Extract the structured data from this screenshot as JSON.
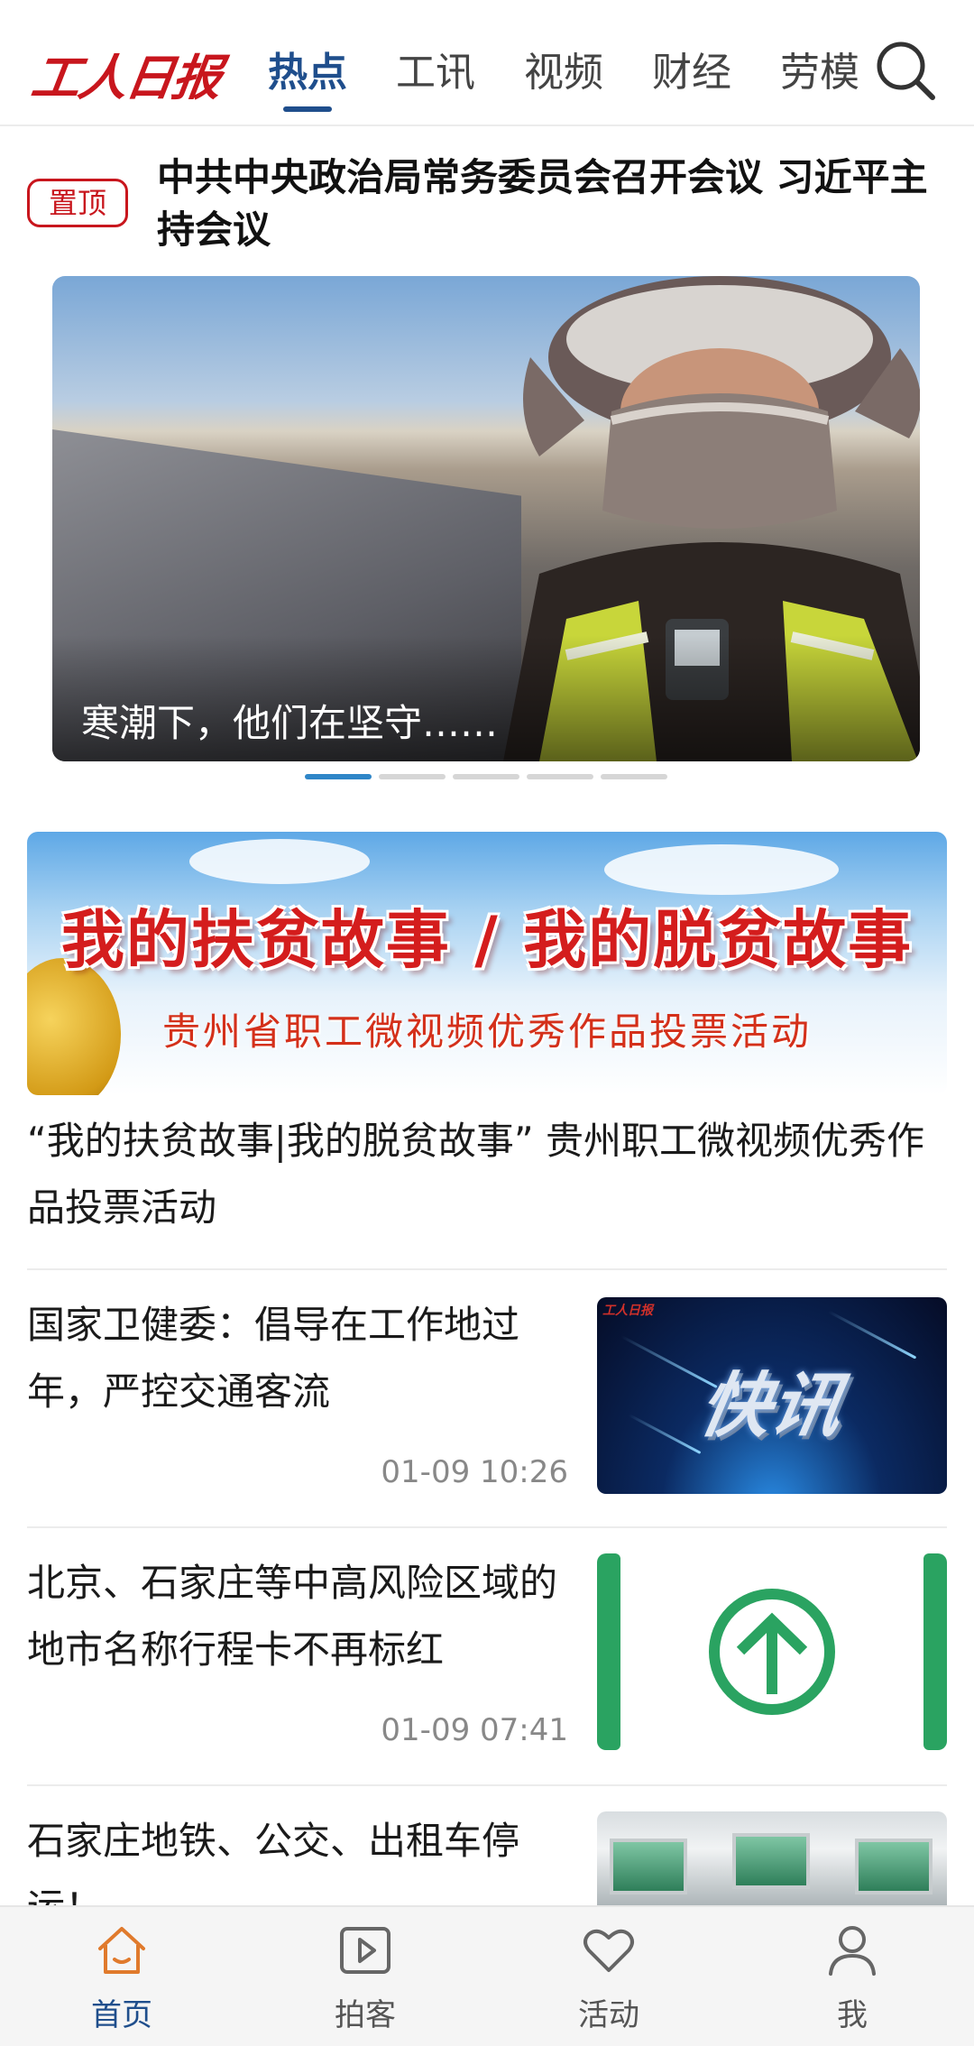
{
  "header": {
    "logo_text": "工人日报",
    "tabs": [
      {
        "label": "热点",
        "active": true
      },
      {
        "label": "工讯",
        "active": false
      },
      {
        "label": "视频",
        "active": false
      },
      {
        "label": "财经",
        "active": false
      },
      {
        "label": "劳模",
        "active": false
      }
    ],
    "search_icon": "search-icon",
    "accent_color": "#1f4e8c",
    "brand_color": "#c8161d"
  },
  "pinned": {
    "badge": "置顶",
    "title": "中共中央政治局常务委员会召开会议 习近平主持会议"
  },
  "carousel": {
    "caption": "寒潮下，他们在坚守……",
    "slide_count": 5,
    "active_index": 0
  },
  "promo": {
    "banner_title": "我的扶贫故事 / 我的脱贫故事",
    "banner_subtitle": "贵州省职工微视频优秀作品投票活动",
    "caption": "“我的扶贫故事|我的脱贫故事” 贵州职工微视频优秀作品投票活动"
  },
  "news": [
    {
      "title": "国家卫健委：倡导在工作地过年，严控交通客流",
      "time": "01-09 10:26",
      "thumb_text": "快讯",
      "thumb_logo": "工人日报"
    },
    {
      "title": "北京、石家庄等中高风险区域的地市名称行程卡不再标红",
      "time": "01-09 07:41"
    },
    {
      "title": "石家庄地铁、公交、出租车停运！",
      "time": ""
    }
  ],
  "bottom_nav": [
    {
      "label": "首页",
      "icon": "home-icon",
      "active": true
    },
    {
      "label": "拍客",
      "icon": "play-icon",
      "active": false
    },
    {
      "label": "活动",
      "icon": "heart-icon",
      "active": false
    },
    {
      "label": "我",
      "icon": "user-icon",
      "active": false
    }
  ]
}
